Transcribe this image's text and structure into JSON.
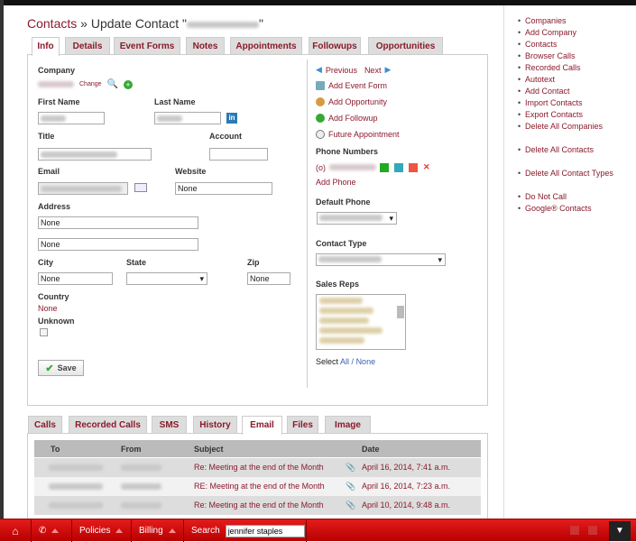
{
  "header": {
    "breadcrumb_link": "Contacts",
    "separator": " » ",
    "title_prefix": "Update Contact \"",
    "title_suffix": "\""
  },
  "tabs": [
    {
      "label": "Info",
      "active": true
    },
    {
      "label": "Details"
    },
    {
      "label": "Event Forms"
    },
    {
      "label": "Notes"
    },
    {
      "label": "Appointments"
    },
    {
      "label": "Followups"
    },
    {
      "label": "Opportunities"
    }
  ],
  "form": {
    "company_label": "Company",
    "change_link": "Change",
    "first_name_label": "First Name",
    "last_name_label": "Last Name",
    "title_label": "Title",
    "account_label": "Account",
    "email_label": "Email",
    "website_label": "Website",
    "website_value": "None",
    "address_label": "Address",
    "address1_value": "None",
    "address2_value": "None",
    "city_label": "City",
    "city_value": "None",
    "state_label": "State",
    "zip_label": "Zip",
    "zip_value": "None",
    "country_label": "Country",
    "country_value": "None",
    "unknown_label": "Unknown",
    "save_label": "Save"
  },
  "actions": {
    "previous": "Previous",
    "next": "Next",
    "add_event_form": "Add Event Form",
    "add_opportunity": "Add Opportunity",
    "add_followup": "Add Followup",
    "future_appointment": "Future Appointment",
    "phone_numbers_label": "Phone Numbers",
    "phone_prefix": "(o)",
    "add_phone": "Add Phone",
    "default_phone_label": "Default Phone",
    "contact_type_label": "Contact Type",
    "sales_reps_label": "Sales Reps",
    "select_label": "Select",
    "select_all": "All",
    "select_sep": " / ",
    "select_none": "None"
  },
  "sidebar": {
    "items": [
      "Companies",
      "Add Company",
      "Contacts",
      "Browser Calls",
      "Recorded Calls",
      "Autotext",
      "Add Contact",
      "Import Contacts",
      "Export Contacts",
      "Delete All Companies",
      "Delete All Contacts",
      "Delete All Contact Types",
      "Do Not Call",
      "Google® Contacts"
    ]
  },
  "bottom_tabs": [
    {
      "label": "Calls"
    },
    {
      "label": "Recorded Calls"
    },
    {
      "label": "SMS"
    },
    {
      "label": "History"
    },
    {
      "label": "Email",
      "active": true
    },
    {
      "label": "Files"
    },
    {
      "label": "Image"
    }
  ],
  "email_table": {
    "columns": [
      "To",
      "From",
      "Subject",
      "Date"
    ],
    "rows": [
      {
        "subject": "Re: Meeting at the end of the Month",
        "date": "April 16, 2014, 7:41 a.m."
      },
      {
        "subject": "RE: Meeting at the end of the Month",
        "date": "April 16, 2014, 7:23 a.m."
      },
      {
        "subject": "Re: Meeting at the end of the Month",
        "date": "April 10, 2014, 9:48 a.m."
      }
    ]
  },
  "bottombar": {
    "policies": "Policies",
    "billing": "Billing",
    "search_label": "Search",
    "search_value": "jennifer staples"
  },
  "colors": {
    "accent": "#8b1a2b",
    "bar": "#d40000"
  }
}
